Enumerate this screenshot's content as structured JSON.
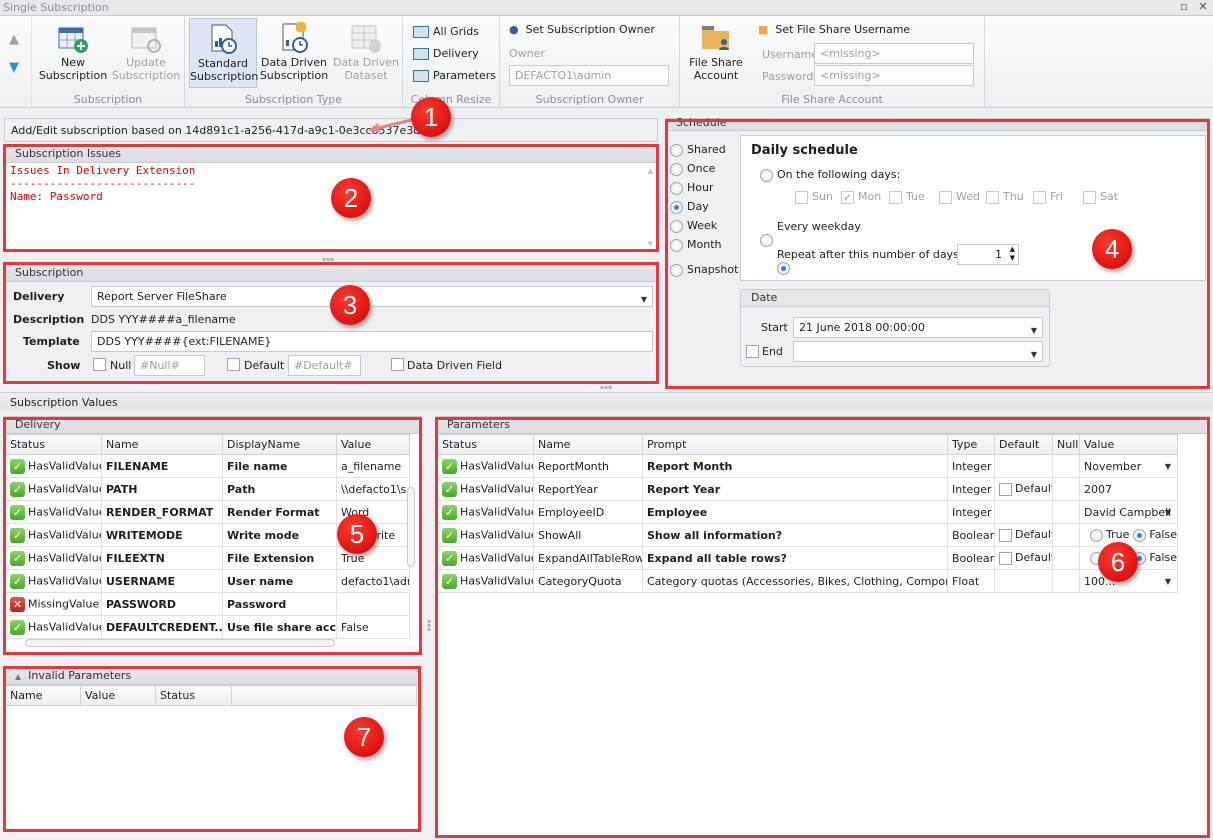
{
  "window": {
    "title": "Single Subscription",
    "maximize_icon": "maximize-icon",
    "close_icon": "close-icon"
  },
  "ribbon": {
    "nav": {
      "up_icon": "arrow-up-icon",
      "down_icon": "arrow-down-icon"
    },
    "subscription_group": {
      "label": "Subscription",
      "new": "New Subscription",
      "update": "Update Subscription"
    },
    "type_group": {
      "label": "Subscription Type",
      "standard": "Standard Subscription",
      "data_driven": "Data Driven Subscription",
      "dataset": "Data Driven Dataset"
    },
    "resize_group": {
      "label": "Column Resize",
      "items": [
        "All Grids",
        "Delivery",
        "Parameters"
      ]
    },
    "owner_group": {
      "label": "Subscription Owner",
      "set_owner": "Set Subscription Owner",
      "owner_label": "Owner",
      "owner_value": "DEFACTO1\\admin"
    },
    "fileshare_group": {
      "label": "File Share Account",
      "account_button": "File Share Account",
      "set_username": "Set File Share Username",
      "username_label": "Username",
      "username_value": "<missing>",
      "password_label": "Password",
      "password_value": "<missing>"
    }
  },
  "info_bar": {
    "text": "Add/Edit subscription based on 14d891c1-a256-417d-a9c1-0e3cc8537e3d"
  },
  "issues": {
    "title": "Subscription Issues",
    "lines": [
      "Issues In Delivery Extension",
      "----------------------------",
      "Name: Password"
    ]
  },
  "subscription": {
    "title": "Subscription",
    "delivery_label": "Delivery",
    "delivery_value": "Report Server FileShare",
    "description_label": "Description",
    "description_value": "DDS YYY####a_filename",
    "template_label": "Template",
    "template_value": "DDS YYY####{ext:FILENAME}",
    "show_label": "Show",
    "null_label": "Null",
    "null_placeholder": "#Null#",
    "default_label": "Default",
    "default_placeholder": "#Default#",
    "data_driven_label": "Data Driven Field"
  },
  "schedule": {
    "title": "Schedule",
    "types": [
      {
        "label": "Shared",
        "selected": false
      },
      {
        "label": "Once",
        "selected": false
      },
      {
        "label": "Hour",
        "selected": false
      },
      {
        "label": "Day",
        "selected": true
      },
      {
        "label": "Week",
        "selected": false
      },
      {
        "label": "Month",
        "selected": false
      },
      {
        "label": "Snapshot",
        "selected": false
      }
    ],
    "daily": {
      "title": "Daily schedule",
      "following_days": "On the following days:",
      "days": [
        {
          "label": "Sun",
          "checked": false
        },
        {
          "label": "Mon",
          "checked": true
        },
        {
          "label": "Tue",
          "checked": false
        },
        {
          "label": "Wed",
          "checked": false
        },
        {
          "label": "Thu",
          "checked": false
        },
        {
          "label": "Fri",
          "checked": false
        },
        {
          "label": "Sat",
          "checked": false
        }
      ],
      "every_weekday": "Every weekday",
      "repeat": "Repeat after this number of days",
      "repeat_value": "1"
    },
    "date": {
      "title": "Date",
      "start_label": "Start",
      "start_value": "21 June 2018 00:00:00",
      "end_label": "End",
      "end_value": ""
    }
  },
  "values_title": "Subscription Values",
  "delivery_grid": {
    "title": "Delivery",
    "columns": [
      "Status",
      "Name",
      "DisplayName",
      "Value"
    ],
    "rows": [
      {
        "status": "HasValidValue",
        "ok": true,
        "name": "FILENAME",
        "display": "File name",
        "value": "a_filename"
      },
      {
        "status": "HasValidValue",
        "ok": true,
        "name": "PATH",
        "display": "Path",
        "value": "\\\\defacto1\\s"
      },
      {
        "status": "HasValidValue",
        "ok": true,
        "name": "RENDER_FORMAT",
        "display": "Render Format",
        "value": "Word"
      },
      {
        "status": "HasValidValue",
        "ok": true,
        "name": "WRITEMODE",
        "display": "Write mode",
        "value": "Overwrite"
      },
      {
        "status": "HasValidValue",
        "ok": true,
        "name": "FILEEXTN",
        "display": "File Extension",
        "value": "True"
      },
      {
        "status": "HasValidValue",
        "ok": true,
        "name": "USERNAME",
        "display": "User name",
        "value": "defacto1\\adr"
      },
      {
        "status": "MissingValue",
        "ok": false,
        "name": "PASSWORD",
        "display": "Password",
        "value": ""
      },
      {
        "status": "HasValidValue",
        "ok": true,
        "name": "DEFAULTCREDENT...",
        "display": "Use file share acc...",
        "value": "False"
      }
    ]
  },
  "parameters_grid": {
    "title": "Parameters",
    "columns": [
      "Status",
      "Name",
      "Prompt",
      "Type",
      "Default",
      "Null",
      "Value"
    ],
    "rows": [
      {
        "status": "HasValidValue",
        "name": "ReportMonth",
        "prompt": "Report Month",
        "bold": true,
        "type": "Integer",
        "default": null,
        "value": "November",
        "kind": "dropdown"
      },
      {
        "status": "HasValidValue",
        "name": "ReportYear",
        "prompt": "Report Year",
        "bold": true,
        "type": "Integer",
        "default": "Default",
        "value": "2007",
        "kind": "text"
      },
      {
        "status": "HasValidValue",
        "name": "EmployeeID",
        "prompt": "Employee",
        "bold": true,
        "type": "Integer",
        "default": null,
        "value": "David Campbell",
        "kind": "dropdown"
      },
      {
        "status": "HasValidValue",
        "name": "ShowAll",
        "prompt": "Show all information?",
        "bold": true,
        "type": "Boolean",
        "default": "Default",
        "value": "False",
        "kind": "bool"
      },
      {
        "status": "HasValidValue",
        "name": "ExpandAllTableRows",
        "prompt": "Expand all table rows?",
        "bold": true,
        "type": "Boolean",
        "default": "Default",
        "value": "False",
        "kind": "bool"
      },
      {
        "status": "HasValidValue",
        "name": "CategoryQuota",
        "prompt": "Category quotas (Accessories, Bikes, Clothing, Components):",
        "bold": false,
        "type": "Float",
        "default": null,
        "value": "100...",
        "kind": "dropdown"
      }
    ],
    "bool_true": "True",
    "bool_false": "False"
  },
  "invalid_grid": {
    "title": "Invalid Parameters",
    "columns": [
      "Name",
      "Value",
      "Status"
    ]
  },
  "markers": [
    "1",
    "2",
    "3",
    "4",
    "5",
    "6",
    "7"
  ],
  "colors": {
    "annotation_red": "#e8363c",
    "issue_text": "#e80000",
    "selection_blue": "#dde6f4"
  }
}
